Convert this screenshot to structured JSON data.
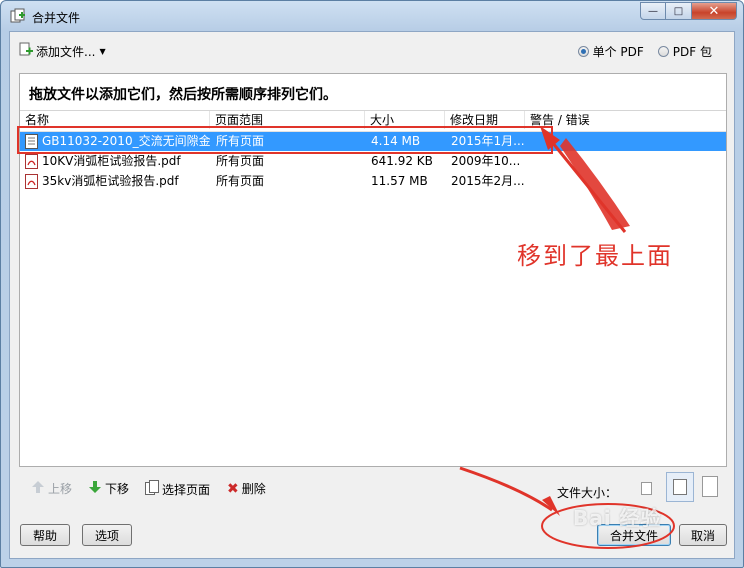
{
  "window": {
    "title": "合并文件"
  },
  "toolbar": {
    "add_files_label": "添加文件...",
    "radios": [
      {
        "label": "单个 PDF",
        "selected": true
      },
      {
        "label": "PDF 包",
        "selected": false
      }
    ]
  },
  "instruction": "拖放文件以添加它们，然后按所需顺序排列它们。",
  "table": {
    "columns": [
      "名称",
      "页面范围",
      "大小",
      "修改日期",
      "警告 / 错误"
    ],
    "rows": [
      {
        "name": "GB11032-2010_交流无间隙金...",
        "range": "所有页面",
        "size": "4.14 MB",
        "date": "2015年1月...",
        "warning": "",
        "selected": true,
        "icon": "document-icon"
      },
      {
        "name": "10KV消弧柜试验报告.pdf",
        "range": "所有页面",
        "size": "641.92 KB",
        "date": "2009年10...",
        "warning": "",
        "selected": false,
        "icon": "pdf-icon"
      },
      {
        "name": "35kv消弧柜试验报告.pdf",
        "range": "所有页面",
        "size": "11.57 MB",
        "date": "2015年2月...",
        "warning": "",
        "selected": false,
        "icon": "pdf-icon"
      }
    ]
  },
  "actions": {
    "move_up": "上移",
    "move_down": "下移",
    "choose_pages": "选择页面",
    "delete": "删除",
    "file_size_label": "文件大小："
  },
  "footer": {
    "help": "帮助",
    "options": "选项",
    "combine": "合并文件",
    "cancel": "取消"
  },
  "annotation": {
    "text": "移到了最上面"
  },
  "watermark": "Bai 经验",
  "colors": {
    "selection": "#3399ff",
    "annotation": "#e0342a"
  }
}
